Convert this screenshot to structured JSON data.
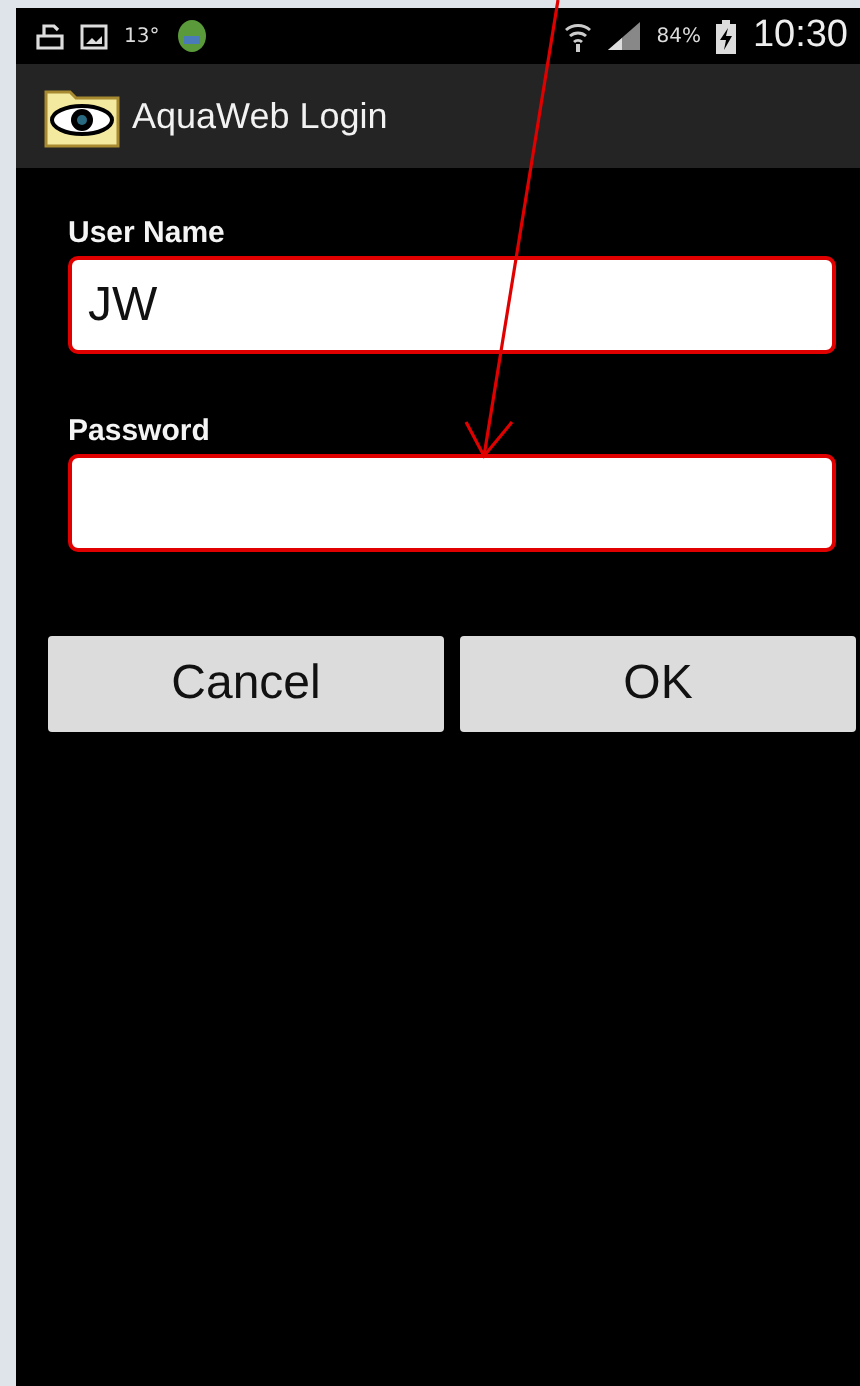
{
  "status_bar": {
    "temperature": "13°",
    "battery": "84%",
    "time": "10:30"
  },
  "action_bar": {
    "title": "AquaWeb Login"
  },
  "fields": [
    {
      "label": "User Name",
      "value": "JW",
      "highlighted": true
    },
    {
      "label": "Password",
      "highlighted": true
    }
  ],
  "buttons": [
    "Cancel",
    "OK"
  ]
}
